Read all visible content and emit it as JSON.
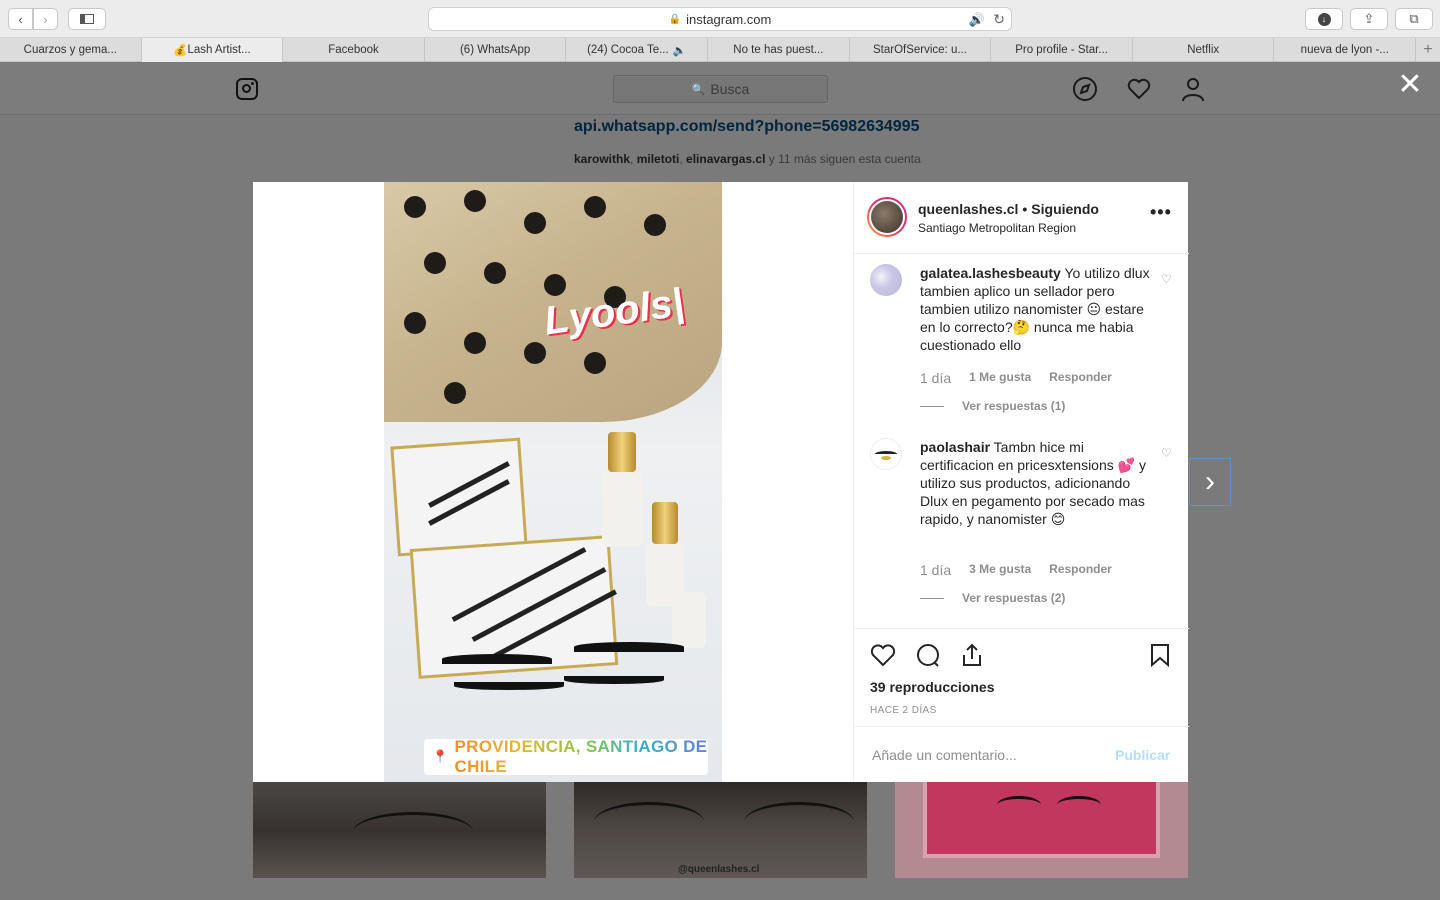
{
  "browser": {
    "url": "instagram.com",
    "tabs": [
      {
        "label": "Cuarzos y gema...",
        "active": false
      },
      {
        "label": "Lash Artist...",
        "active": true,
        "emoji": "💰"
      },
      {
        "label": "Facebook",
        "active": false
      },
      {
        "label": "(6) WhatsApp",
        "active": false
      },
      {
        "label": "(24) Cocoa Te...",
        "active": false,
        "muted": true
      },
      {
        "label": "No te has puest...",
        "active": false
      },
      {
        "label": "StarOfService: u...",
        "active": false
      },
      {
        "label": "Pro profile - Star...",
        "active": false
      },
      {
        "label": "Netflix",
        "active": false
      },
      {
        "label": "nueva de lyon -...",
        "active": false
      }
    ]
  },
  "instagram": {
    "search_placeholder": "Busca",
    "profile_link": "api.whatsapp.com/send?phone=56982634995",
    "followers": {
      "names": [
        "karowithk",
        "miletoti",
        "elinavargas.cl"
      ],
      "suffix": "y 11 más siguen esta cuenta"
    },
    "thumb_tag": "@queenlashes.cl"
  },
  "post": {
    "stickers": {
      "gif_text": "Lyools|",
      "location": "PROVIDENCIA, SANTIAGO DE CHILE"
    },
    "username": "queenlashes.cl",
    "follow_state": "Siguiendo",
    "location": "Santiago Metropolitan Region",
    "comments": [
      {
        "user": "galatea.lashesbeauty",
        "text": "Yo utilizo dlux tambien aplico un sellador pero tambien utilizo nanomister 😐 estare en lo correcto?🤔 nunca me habia cuestionado ello",
        "age": "1 día",
        "likes": "1 Me gusta",
        "reply": "Responder",
        "view_replies": "Ver respuestas (1)"
      },
      {
        "user": "paolashair",
        "text": "Tambn hice mi certificacion en pricesxtensions 💕 y utilizo sus productos, adicionando Dlux en pegamento por secado mas rapido, y nanomister 😊",
        "age": "1 día",
        "likes": "3 Me gusta",
        "reply": "Responder",
        "view_replies": "Ver respuestas (2)"
      }
    ],
    "views": "39 reproducciones",
    "time_ago": "HACE 2 DÍAS",
    "comment_placeholder": "Añade un comentario...",
    "publish_label": "Publicar"
  },
  "colors": {
    "link_blue": "#00253e",
    "publish_disabled": "#b2dffc",
    "muted_gray": "#8e8e8e"
  }
}
